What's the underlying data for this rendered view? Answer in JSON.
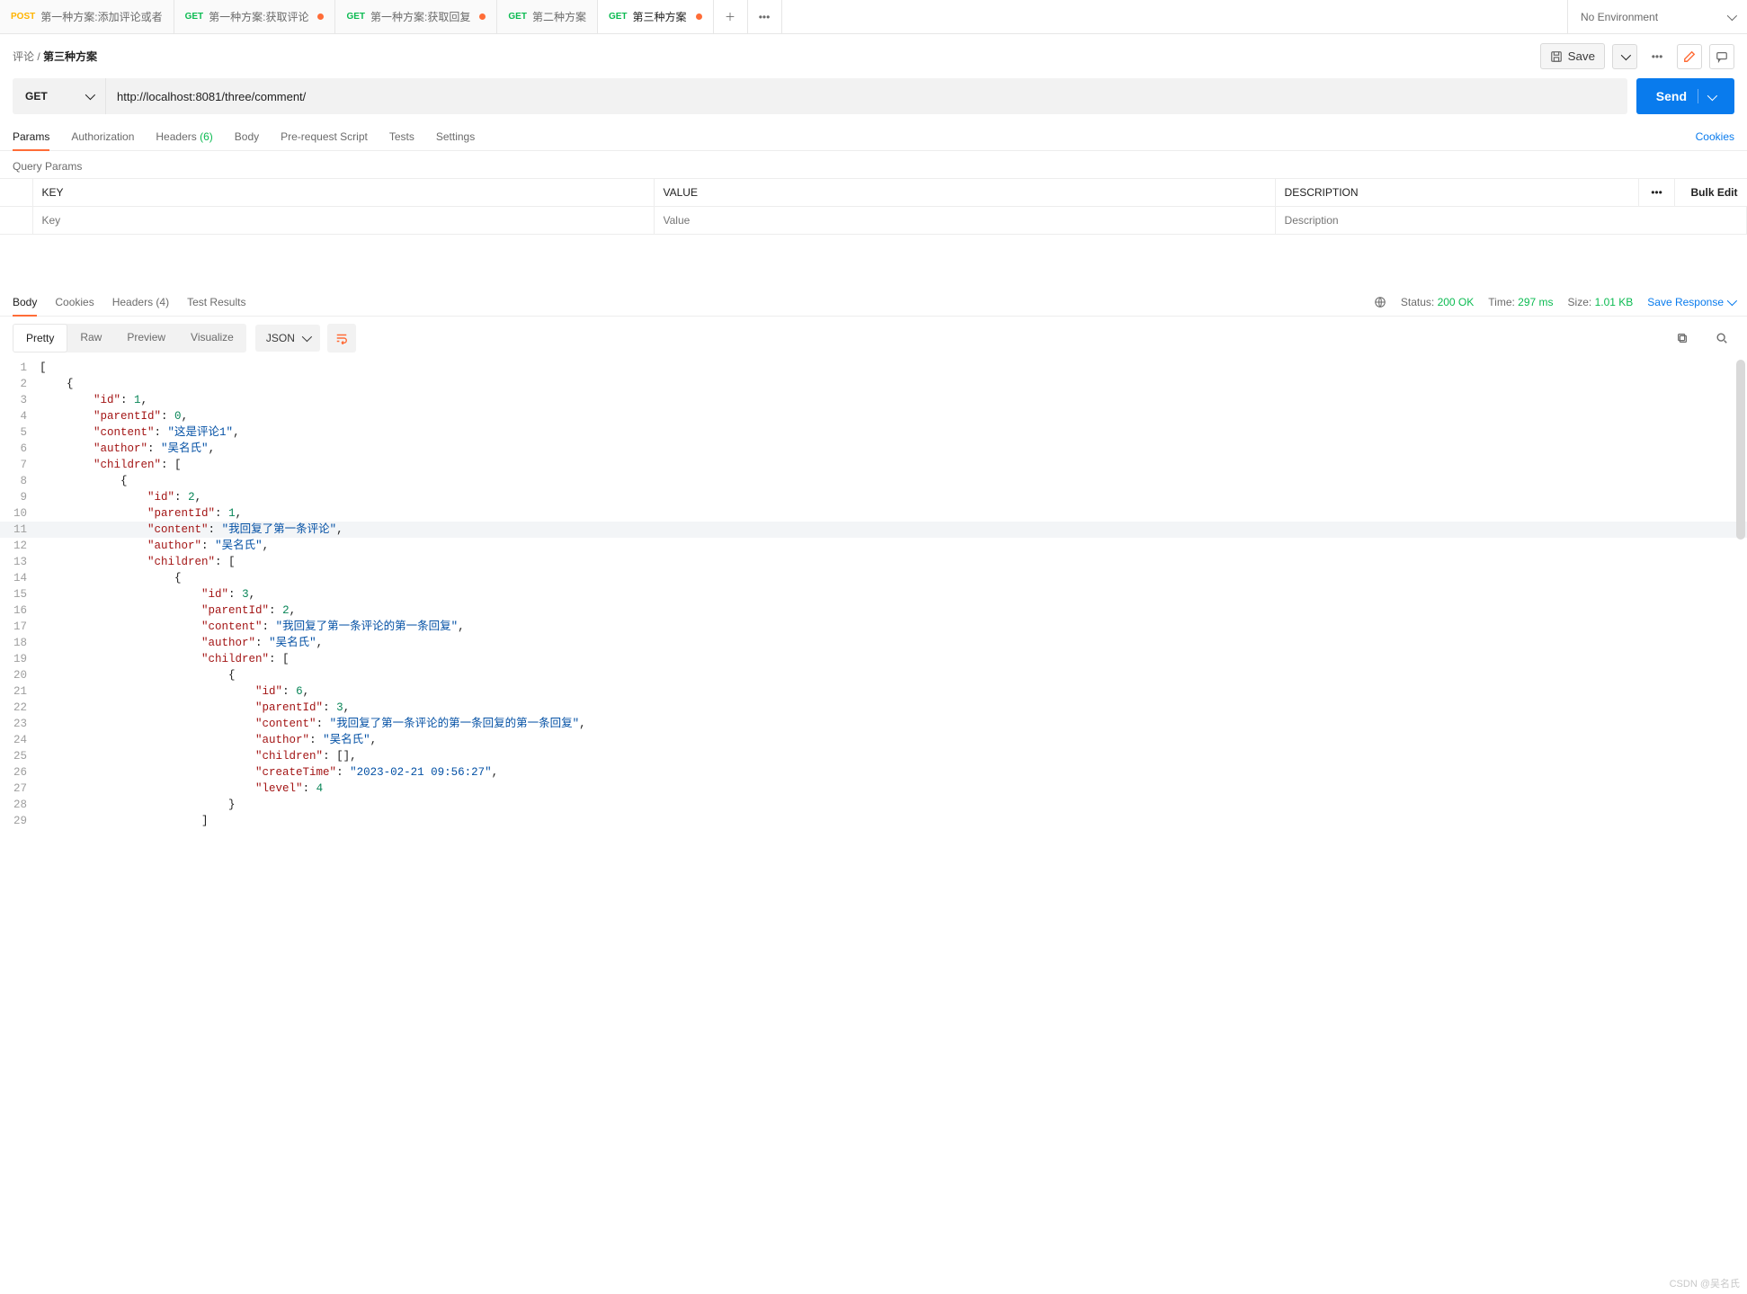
{
  "tabs": [
    {
      "method": "POST",
      "label": "第一种方案:添加评论或者",
      "modified": false
    },
    {
      "method": "GET",
      "label": "第一种方案:获取评论",
      "modified": true
    },
    {
      "method": "GET",
      "label": "第一种方案:获取回复",
      "modified": true
    },
    {
      "method": "GET",
      "label": "第二种方案",
      "modified": false
    },
    {
      "method": "GET",
      "label": "第三种方案",
      "modified": true,
      "active": true
    }
  ],
  "environment": {
    "label": "No Environment"
  },
  "breadcrumb": {
    "parent": "评论",
    "current": "第三种方案"
  },
  "toolbar": {
    "save": "Save"
  },
  "request": {
    "method": "GET",
    "url": "http://localhost:8081/three/comment/",
    "send": "Send"
  },
  "request_tabs": {
    "params": "Params",
    "authorization": "Authorization",
    "headers": "Headers",
    "headers_count": "(6)",
    "body": "Body",
    "pre_request": "Pre-request Script",
    "tests": "Tests",
    "settings": "Settings",
    "cookies": "Cookies"
  },
  "query_params": {
    "title": "Query Params",
    "cols": {
      "key": "KEY",
      "value": "VALUE",
      "description": "DESCRIPTION",
      "bulk": "Bulk Edit"
    },
    "placeholders": {
      "key": "Key",
      "value": "Value",
      "description": "Description"
    }
  },
  "response_tabs": {
    "body": "Body",
    "cookies": "Cookies",
    "headers": "Headers",
    "headers_count": "(4)",
    "test_results": "Test Results"
  },
  "response_meta": {
    "status_label": "Status:",
    "status_value": "200 OK",
    "time_label": "Time:",
    "time_value": "297 ms",
    "size_label": "Size:",
    "size_value": "1.01 KB",
    "save_response": "Save Response"
  },
  "view_modes": {
    "pretty": "Pretty",
    "raw": "Raw",
    "preview": "Preview",
    "visualize": "Visualize",
    "lang": "JSON"
  },
  "code_lines": [
    [
      {
        "t": "p",
        "v": "["
      }
    ],
    [
      {
        "t": "p",
        "v": "    {"
      }
    ],
    [
      {
        "t": "p",
        "v": "        "
      },
      {
        "t": "k",
        "v": "\"id\""
      },
      {
        "t": "p",
        "v": ": "
      },
      {
        "t": "n",
        "v": "1"
      },
      {
        "t": "p",
        "v": ","
      }
    ],
    [
      {
        "t": "p",
        "v": "        "
      },
      {
        "t": "k",
        "v": "\"parentId\""
      },
      {
        "t": "p",
        "v": ": "
      },
      {
        "t": "n",
        "v": "0"
      },
      {
        "t": "p",
        "v": ","
      }
    ],
    [
      {
        "t": "p",
        "v": "        "
      },
      {
        "t": "k",
        "v": "\"content\""
      },
      {
        "t": "p",
        "v": ": "
      },
      {
        "t": "s",
        "v": "\"这是评论1\""
      },
      {
        "t": "p",
        "v": ","
      }
    ],
    [
      {
        "t": "p",
        "v": "        "
      },
      {
        "t": "k",
        "v": "\"author\""
      },
      {
        "t": "p",
        "v": ": "
      },
      {
        "t": "s",
        "v": "\"吴名氏\""
      },
      {
        "t": "p",
        "v": ","
      }
    ],
    [
      {
        "t": "p",
        "v": "        "
      },
      {
        "t": "k",
        "v": "\"children\""
      },
      {
        "t": "p",
        "v": ": ["
      }
    ],
    [
      {
        "t": "p",
        "v": "            {"
      }
    ],
    [
      {
        "t": "p",
        "v": "                "
      },
      {
        "t": "k",
        "v": "\"id\""
      },
      {
        "t": "p",
        "v": ": "
      },
      {
        "t": "n",
        "v": "2"
      },
      {
        "t": "p",
        "v": ","
      }
    ],
    [
      {
        "t": "p",
        "v": "                "
      },
      {
        "t": "k",
        "v": "\"parentId\""
      },
      {
        "t": "p",
        "v": ": "
      },
      {
        "t": "n",
        "v": "1"
      },
      {
        "t": "p",
        "v": ","
      }
    ],
    [
      {
        "t": "p",
        "v": "                "
      },
      {
        "t": "k",
        "v": "\"content\""
      },
      {
        "t": "p",
        "v": ": "
      },
      {
        "t": "s",
        "v": "\"我回复了第一条评论\""
      },
      {
        "t": "p",
        "v": ","
      }
    ],
    [
      {
        "t": "p",
        "v": "                "
      },
      {
        "t": "k",
        "v": "\"author\""
      },
      {
        "t": "p",
        "v": ": "
      },
      {
        "t": "s",
        "v": "\"吴名氏\""
      },
      {
        "t": "p",
        "v": ","
      }
    ],
    [
      {
        "t": "p",
        "v": "                "
      },
      {
        "t": "k",
        "v": "\"children\""
      },
      {
        "t": "p",
        "v": ": ["
      }
    ],
    [
      {
        "t": "p",
        "v": "                    {"
      }
    ],
    [
      {
        "t": "p",
        "v": "                        "
      },
      {
        "t": "k",
        "v": "\"id\""
      },
      {
        "t": "p",
        "v": ": "
      },
      {
        "t": "n",
        "v": "3"
      },
      {
        "t": "p",
        "v": ","
      }
    ],
    [
      {
        "t": "p",
        "v": "                        "
      },
      {
        "t": "k",
        "v": "\"parentId\""
      },
      {
        "t": "p",
        "v": ": "
      },
      {
        "t": "n",
        "v": "2"
      },
      {
        "t": "p",
        "v": ","
      }
    ],
    [
      {
        "t": "p",
        "v": "                        "
      },
      {
        "t": "k",
        "v": "\"content\""
      },
      {
        "t": "p",
        "v": ": "
      },
      {
        "t": "s",
        "v": "\"我回复了第一条评论的第一条回复\""
      },
      {
        "t": "p",
        "v": ","
      }
    ],
    [
      {
        "t": "p",
        "v": "                        "
      },
      {
        "t": "k",
        "v": "\"author\""
      },
      {
        "t": "p",
        "v": ": "
      },
      {
        "t": "s",
        "v": "\"吴名氏\""
      },
      {
        "t": "p",
        "v": ","
      }
    ],
    [
      {
        "t": "p",
        "v": "                        "
      },
      {
        "t": "k",
        "v": "\"children\""
      },
      {
        "t": "p",
        "v": ": ["
      }
    ],
    [
      {
        "t": "p",
        "v": "                            {"
      }
    ],
    [
      {
        "t": "p",
        "v": "                                "
      },
      {
        "t": "k",
        "v": "\"id\""
      },
      {
        "t": "p",
        "v": ": "
      },
      {
        "t": "n",
        "v": "6"
      },
      {
        "t": "p",
        "v": ","
      }
    ],
    [
      {
        "t": "p",
        "v": "                                "
      },
      {
        "t": "k",
        "v": "\"parentId\""
      },
      {
        "t": "p",
        "v": ": "
      },
      {
        "t": "n",
        "v": "3"
      },
      {
        "t": "p",
        "v": ","
      }
    ],
    [
      {
        "t": "p",
        "v": "                                "
      },
      {
        "t": "k",
        "v": "\"content\""
      },
      {
        "t": "p",
        "v": ": "
      },
      {
        "t": "s",
        "v": "\"我回复了第一条评论的第一条回复的第一条回复\""
      },
      {
        "t": "p",
        "v": ","
      }
    ],
    [
      {
        "t": "p",
        "v": "                                "
      },
      {
        "t": "k",
        "v": "\"author\""
      },
      {
        "t": "p",
        "v": ": "
      },
      {
        "t": "s",
        "v": "\"吴名氏\""
      },
      {
        "t": "p",
        "v": ","
      }
    ],
    [
      {
        "t": "p",
        "v": "                                "
      },
      {
        "t": "k",
        "v": "\"children\""
      },
      {
        "t": "p",
        "v": ": [],"
      }
    ],
    [
      {
        "t": "p",
        "v": "                                "
      },
      {
        "t": "k",
        "v": "\"createTime\""
      },
      {
        "t": "p",
        "v": ": "
      },
      {
        "t": "s",
        "v": "\"2023-02-21 09:56:27\""
      },
      {
        "t": "p",
        "v": ","
      }
    ],
    [
      {
        "t": "p",
        "v": "                                "
      },
      {
        "t": "k",
        "v": "\"level\""
      },
      {
        "t": "p",
        "v": ": "
      },
      {
        "t": "n",
        "v": "4"
      }
    ],
    [
      {
        "t": "p",
        "v": "                            }"
      }
    ],
    [
      {
        "t": "p",
        "v": "                        ]"
      }
    ]
  ],
  "highlight_line": 11,
  "watermark": "CSDN @吴名氏"
}
